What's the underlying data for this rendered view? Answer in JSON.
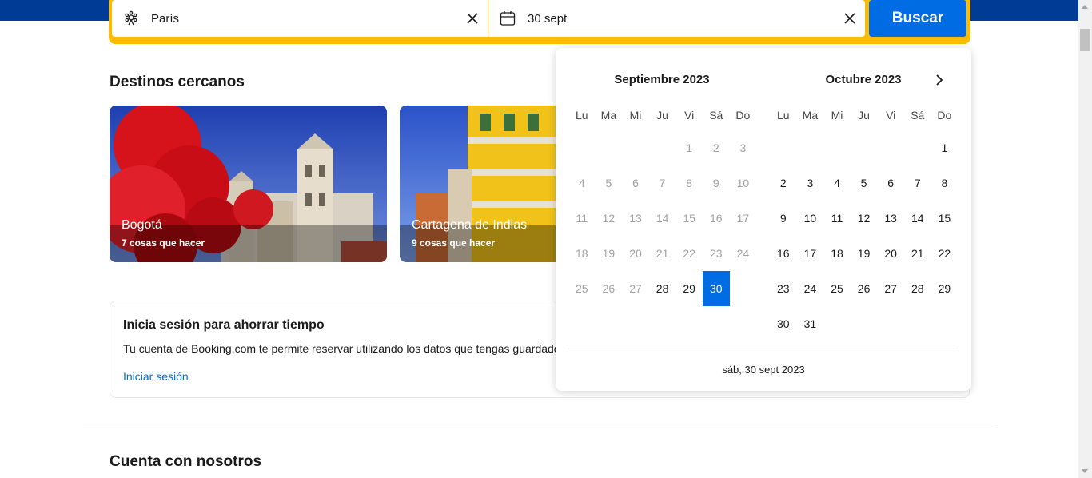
{
  "search": {
    "destination": "París",
    "date": "30 sept",
    "button_label": "Buscar",
    "destination_icon": "ferris-wheel-icon",
    "date_icon": "calendar-icon",
    "clear_icon": "close-icon"
  },
  "nearby": {
    "title": "Destinos cercanos",
    "cards": [
      {
        "name": "Bogotá",
        "subtitle": "7 cosas que hacer"
      },
      {
        "name": "Cartagena de Indias",
        "subtitle": "9 cosas que hacer"
      }
    ]
  },
  "signin": {
    "heading": "Inicia sesión para ahorrar tiempo",
    "text": "Tu cuenta de Booking.com te permite reservar utilizando los datos que tengas guardados",
    "link": "Iniciar sesión"
  },
  "count_on_us": {
    "title": "Cuenta con nosotros"
  },
  "calendar": {
    "weekdays": [
      "Lu",
      "Ma",
      "Mi",
      "Ju",
      "Vi",
      "Sá",
      "Do"
    ],
    "months": [
      {
        "title": "Septiembre 2023",
        "weeks": [
          [
            "",
            "",
            "",
            "",
            "1",
            "2",
            "3"
          ],
          [
            "4",
            "5",
            "6",
            "7",
            "8",
            "9",
            "10"
          ],
          [
            "11",
            "12",
            "13",
            "14",
            "15",
            "16",
            "17"
          ],
          [
            "18",
            "19",
            "20",
            "21",
            "22",
            "23",
            "24"
          ],
          [
            "25",
            "26",
            "27",
            "28",
            "29",
            "30",
            ""
          ]
        ],
        "past_until": 27
      },
      {
        "title": "Octubre 2023",
        "weeks": [
          [
            "",
            "",
            "",
            "",
            "",
            "",
            "1"
          ],
          [
            "2",
            "3",
            "4",
            "5",
            "6",
            "7",
            "8"
          ],
          [
            "9",
            "10",
            "11",
            "12",
            "13",
            "14",
            "15"
          ],
          [
            "16",
            "17",
            "18",
            "19",
            "20",
            "21",
            "22"
          ],
          [
            "23",
            "24",
            "25",
            "26",
            "27",
            "28",
            "29"
          ],
          [
            "30",
            "31",
            "",
            "",
            "",
            "",
            ""
          ]
        ],
        "past_until": 0
      }
    ],
    "selected": {
      "month": 0,
      "day": "30"
    },
    "next_icon": "chevron-right-icon",
    "footer": "sáb, 30 sept 2023"
  },
  "colors": {
    "brand_blue": "#003b95",
    "search_border": "#febb02",
    "button_blue": "#006ce4",
    "link_blue": "#006ce4"
  }
}
